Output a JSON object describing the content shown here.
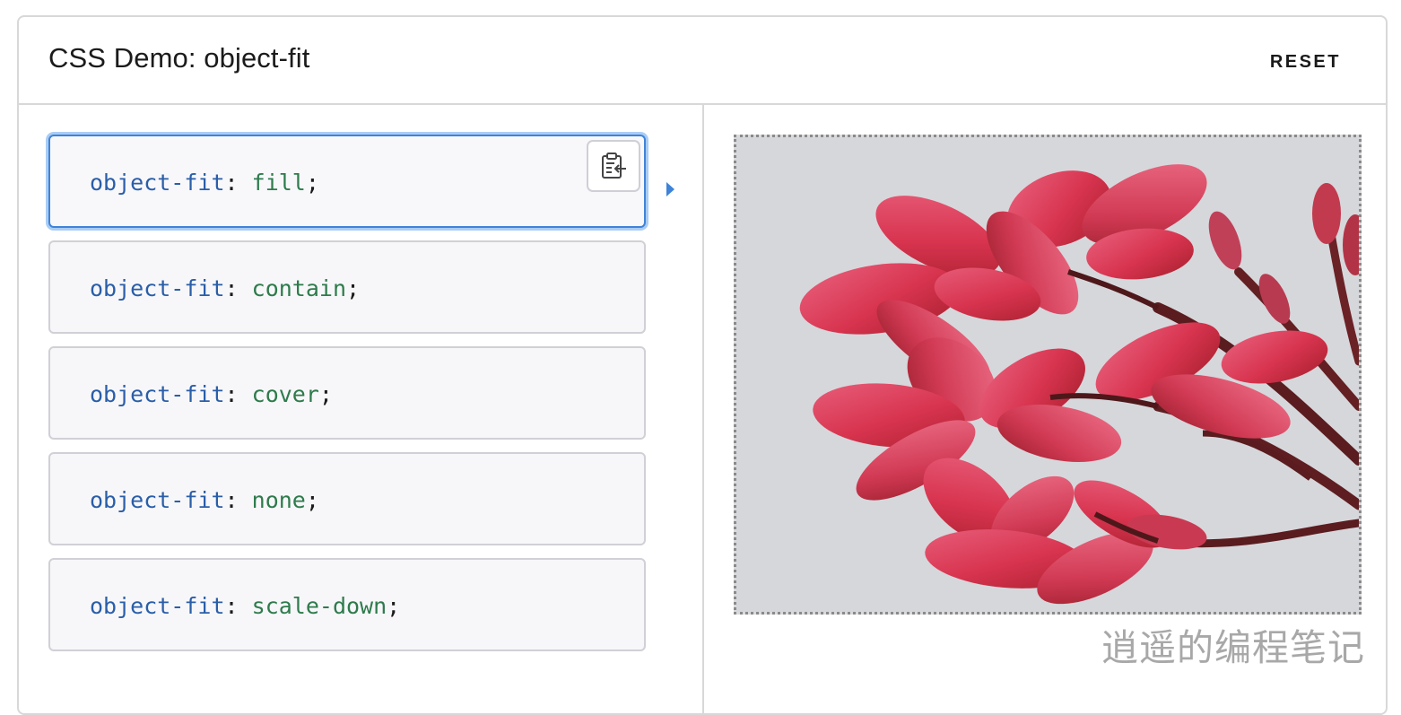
{
  "header": {
    "title": "CSS Demo: object-fit",
    "reset_label": "RESET"
  },
  "choices": [
    {
      "property": "object-fit",
      "colon": ":",
      "value": "fill",
      "semi": ";",
      "selected": true
    },
    {
      "property": "object-fit",
      "colon": ":",
      "value": "contain",
      "semi": ";",
      "selected": false
    },
    {
      "property": "object-fit",
      "colon": ":",
      "value": "cover",
      "semi": ";",
      "selected": false
    },
    {
      "property": "object-fit",
      "colon": ":",
      "value": "none",
      "semi": ";",
      "selected": false
    },
    {
      "property": "object-fit",
      "colon": ":",
      "value": "scale-down",
      "semi": ";",
      "selected": false
    }
  ],
  "copy_button": {
    "icon": "clipboard-paste-icon"
  },
  "output": {
    "image": "red-frangipani-flowers"
  },
  "watermark": "逍遥的编程笔记",
  "colors": {
    "property": "#2a5ea8",
    "value": "#2e7b4c",
    "selected_border": "#3f83d8",
    "selected_glow": "#a9ccf5"
  }
}
